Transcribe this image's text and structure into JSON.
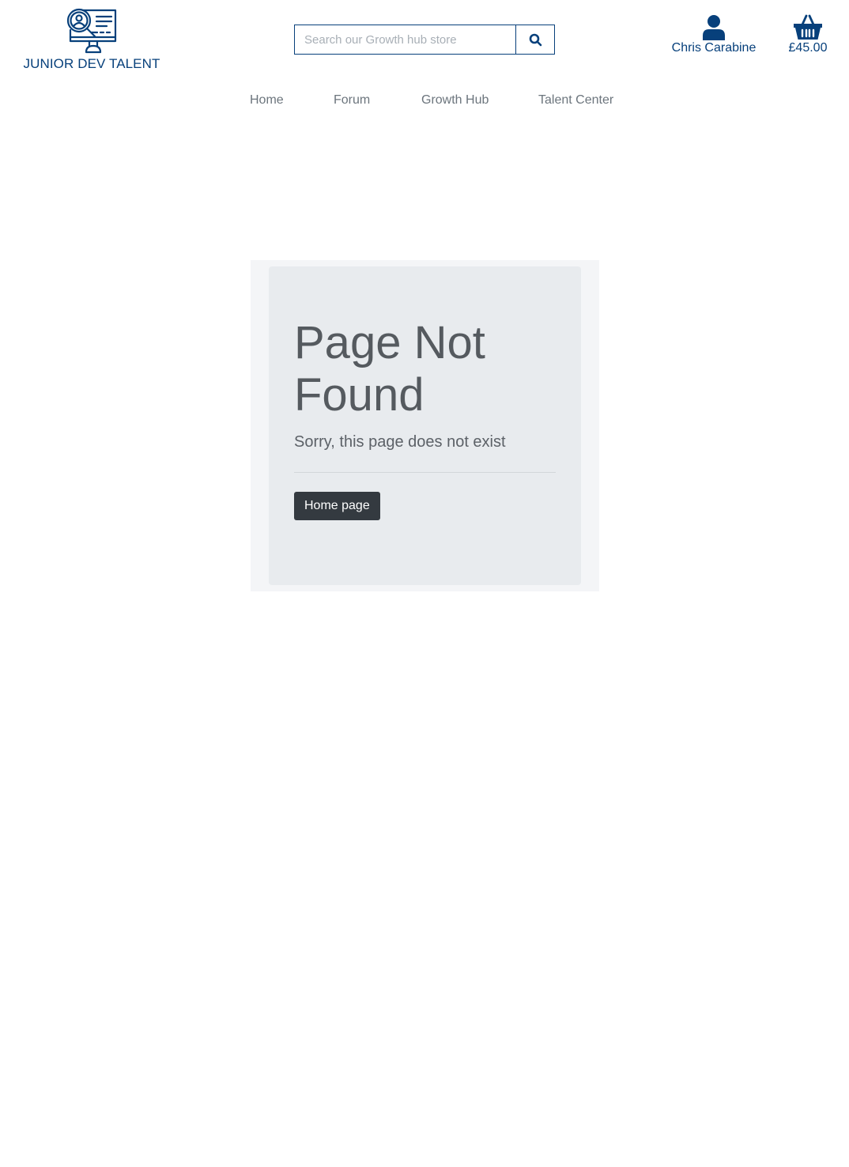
{
  "brand": {
    "name": "JUNIOR DEV TALENT"
  },
  "search": {
    "placeholder": "Search our Growth hub store"
  },
  "account": {
    "user_name": "Chris Carabine"
  },
  "basket": {
    "total": "£45.00"
  },
  "nav": {
    "items": [
      {
        "label": "Home"
      },
      {
        "label": "Forum"
      },
      {
        "label": "Growth Hub"
      },
      {
        "label": "Talent Center"
      }
    ]
  },
  "error_page": {
    "title": "Page Not Found",
    "message": "Sorry, this page does not exist",
    "button_label": "Home page"
  },
  "colors": {
    "brand_blue": "#07407b",
    "button_dark": "#343a40",
    "jumbotron_bg": "#e8ebee",
    "nav_text": "#6c757d"
  },
  "icons": {
    "logo": "monitor-magnifier-person-icon",
    "search": "search-icon",
    "account": "user-icon",
    "basket": "shopping-basket-icon"
  }
}
